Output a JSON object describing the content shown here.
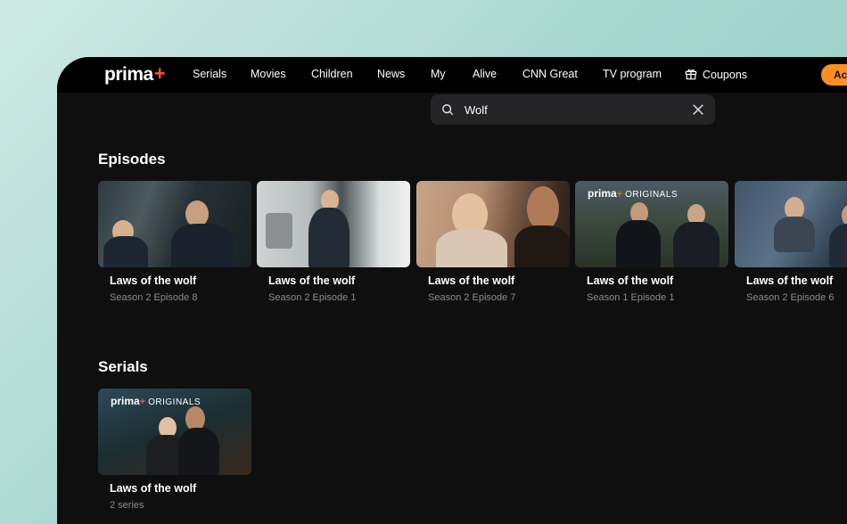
{
  "brand": {
    "name": "prima",
    "plus": "+"
  },
  "nav": {
    "items": [
      {
        "label": "Serials"
      },
      {
        "label": "Movies"
      },
      {
        "label": "Children"
      },
      {
        "label": "News"
      },
      {
        "label": "My"
      },
      {
        "label": "Alive"
      },
      {
        "label": "CNN Great"
      },
      {
        "label": "TV program"
      },
      {
        "label": "Coupons"
      }
    ],
    "action_label": "Ac"
  },
  "search": {
    "value": "Wolf",
    "placeholder": ""
  },
  "sections": {
    "episodes": {
      "title": "Episodes",
      "items": [
        {
          "title": "Laws of the wolf",
          "subtitle": "Season 2 Episode 8"
        },
        {
          "title": "Laws of the wolf",
          "subtitle": "Season 2 Episode 1"
        },
        {
          "title": "Laws of the wolf",
          "subtitle": "Season 2 Episode 7"
        },
        {
          "title": "Laws of the wolf",
          "subtitle": "Season 1 Episode 1"
        },
        {
          "title": "Laws of the wolf",
          "subtitle": "Season 2 Episode 6"
        }
      ]
    },
    "serials": {
      "title": "Serials",
      "items": [
        {
          "title": "Laws of the wolf",
          "subtitle": "2 series"
        }
      ]
    }
  },
  "badges": {
    "prima": "prima",
    "plus": "+",
    "originals": "ORIGINALS"
  },
  "colors": {
    "accent": "#ff8f1f",
    "brand_plus": "#ff5a2a",
    "background": "#0f0f10"
  }
}
